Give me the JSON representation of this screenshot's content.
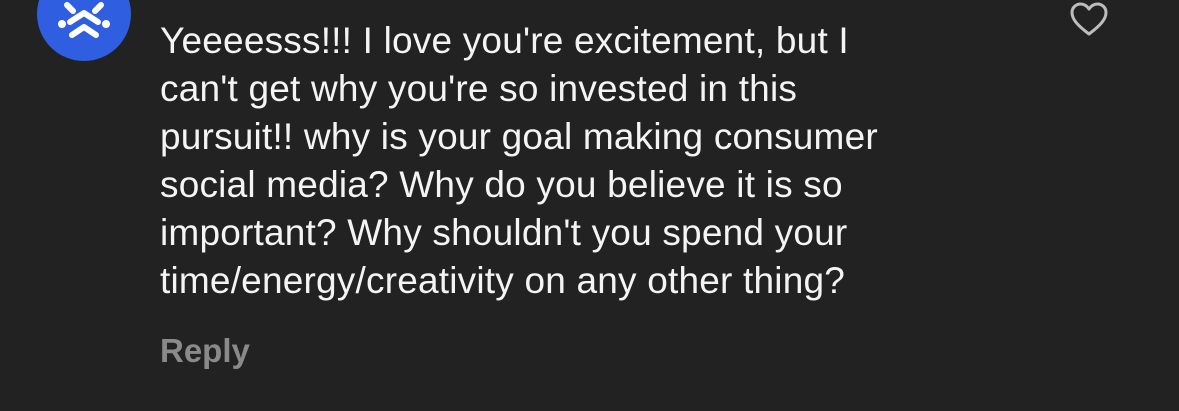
{
  "comment": {
    "author_avatar": "app-logo-avatar",
    "text": "Yeeeesss!!! I love you're excitement, but I\ncan't get why you're so invested in this\npursuit!! why is your goal making consumer\nsocial media? Why do you believe it is so\nimportant? Why shouldn't you spend your\ntime/energy/creativity on any other thing?",
    "reply_label": "Reply",
    "like_icon": "heart-outline-icon"
  },
  "colors": {
    "background": "#222222",
    "text": "#f4f4f4",
    "muted": "#8a8a8a",
    "avatar": "#2f5fe0"
  }
}
